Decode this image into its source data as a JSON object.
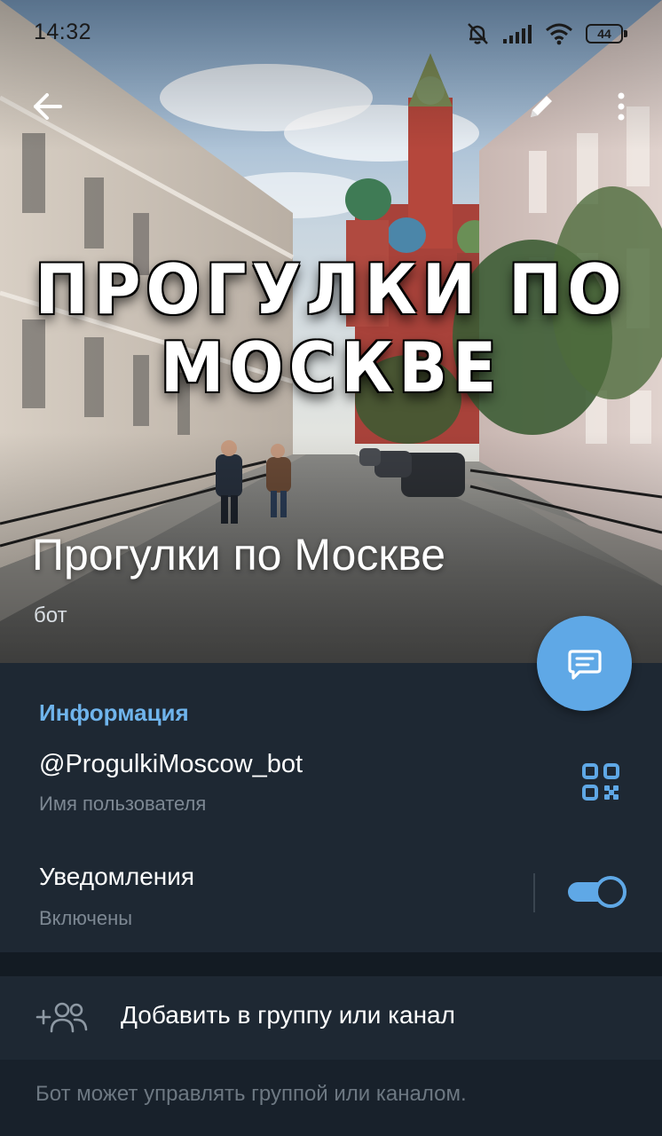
{
  "status_bar": {
    "time": "14:32",
    "battery": "44",
    "icons": [
      "bell-off-icon",
      "signal-icon",
      "wifi-icon",
      "battery-icon"
    ]
  },
  "toolbar": {
    "back_icon": "arrow-left-icon",
    "edit_icon": "pencil-icon",
    "more_icon": "more-vertical-icon"
  },
  "header": {
    "poster_line_1": "ПРОГУЛКИ ПО",
    "poster_line_2": "МОСКВЕ",
    "name": "Прогулки по Москве",
    "subtitle": "бот",
    "fab_icon": "message-icon"
  },
  "info": {
    "section_title": "Информация",
    "username": "@ProgulkiMoscow_bot",
    "username_label": "Имя пользователя",
    "qr_icon": "qr-code-icon",
    "notifications_label": "Уведомления",
    "notifications_status": "Включены",
    "notifications_enabled": true
  },
  "actions": {
    "add_to_group": "Добавить в группу или канал",
    "add_icon": "add-user-icon"
  },
  "footer": {
    "note": "Бот может управлять группой или каналом."
  },
  "colors": {
    "accent": "#5fa8e6",
    "section_title": "#6fb4ec",
    "background": "#1e2833",
    "separator": "#131b23",
    "secondary_text": "#7d8893"
  }
}
